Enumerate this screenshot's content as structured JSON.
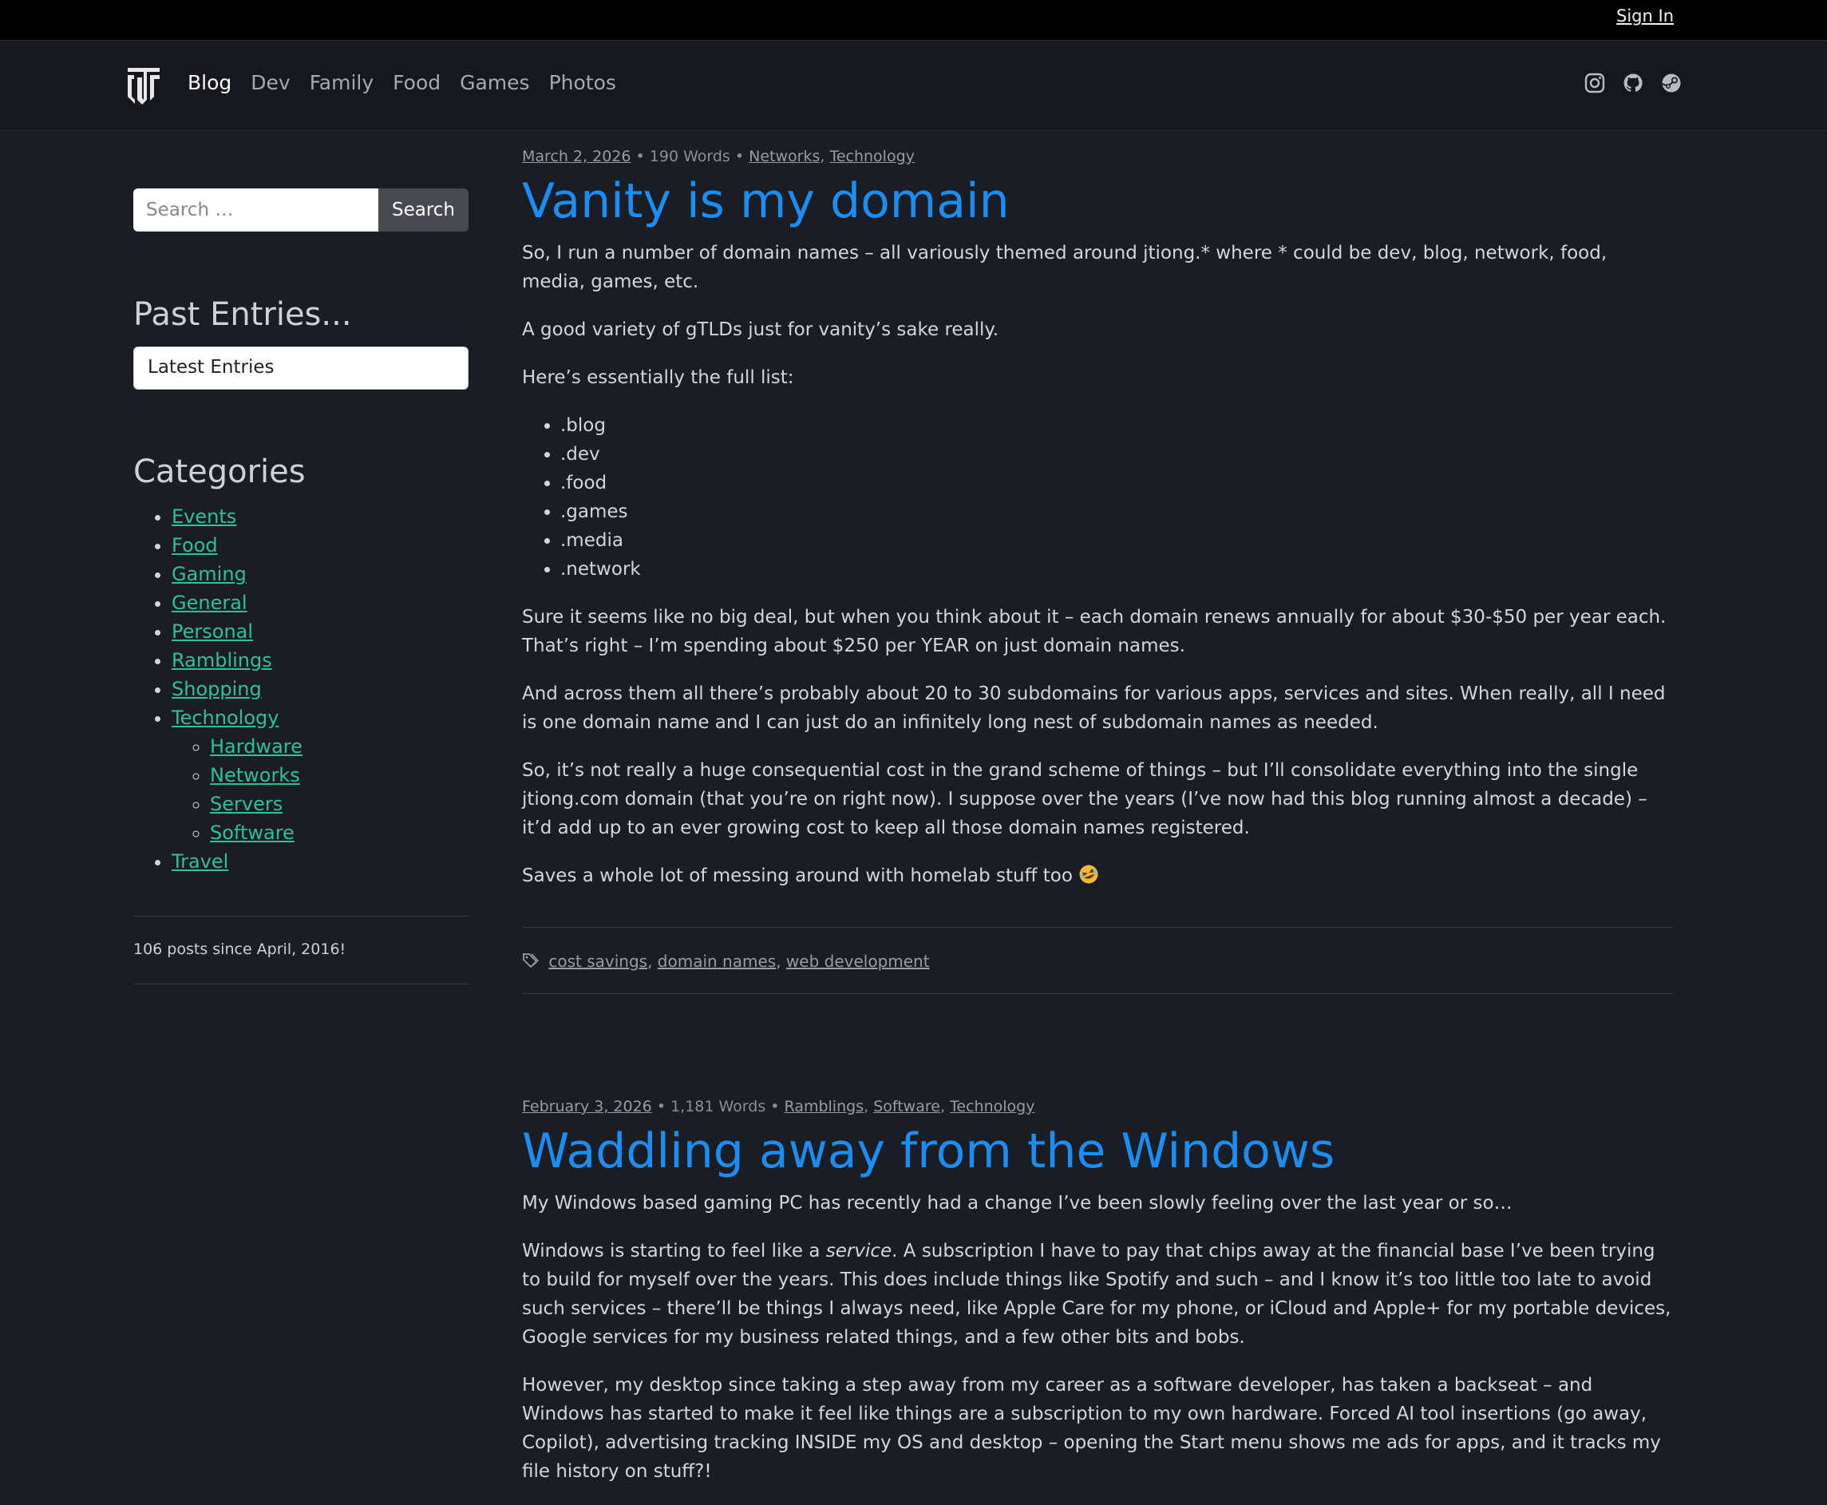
{
  "topbar": {
    "signin_label": "Sign In"
  },
  "nav": {
    "links": [
      "Blog",
      "Dev",
      "Family",
      "Food",
      "Games",
      "Photos"
    ],
    "social_icons": [
      "instagram-icon",
      "github-icon",
      "steam-icon"
    ]
  },
  "sidebar": {
    "search": {
      "placeholder": "Search …",
      "button_label": "Search"
    },
    "past_entries_heading": "Past Entries...",
    "past_entries_selected": "Latest Entries",
    "categories_heading": "Categories",
    "categories": [
      "Events",
      "Food",
      "Gaming",
      "General",
      "Personal",
      "Ramblings",
      "Shopping",
      "Technology"
    ],
    "tech_subcategories": [
      "Hardware",
      "Networks",
      "Servers",
      "Software"
    ],
    "travel": "Travel",
    "posts_count": "106 posts since April, 2016!"
  },
  "posts": [
    {
      "date": "March 2, 2026",
      "words": "190 Words",
      "categories": [
        "Networks",
        "Technology"
      ],
      "title": "Vanity is my domain",
      "p1": "So, I run a number of domain names – all variously themed around jtiong.* where * could be dev, blog, network, food, media, games, etc.",
      "p2": "A good variety of gTLDs just for vanity’s sake really.",
      "p3": "Here’s essentially the full list:",
      "list": [
        ".blog",
        ".dev",
        ".food",
        ".games",
        ".media",
        ".network"
      ],
      "p4": "Sure it seems like no big deal, but when you think about it – each domain renews annually for about $30-$50 per year each. That’s right – I’m spending about $250 per YEAR on just domain names.",
      "p5": "And across them all there’s probably about 20 to 30 subdomains for various apps, services and sites. When really, all I need is one domain name and I can just do an infinitely long nest of subdomain names as needed.",
      "p6": "So, it’s not really a huge consequential cost in the grand scheme of things – but I’ll consolidate everything into the single jtiong.com domain (that you’re on right now). I suppose over the years (I’ve now had this blog running almost a decade) – it’d add up to an ever growing cost to keep all those domain names registered.",
      "p7": "Saves a whole lot of messing around with homelab stuff too",
      "tags": [
        "cost savings",
        "domain names",
        "web development"
      ]
    },
    {
      "date": "February 3, 2026",
      "words": "1,181 Words",
      "categories": [
        "Ramblings",
        "Software",
        "Technology"
      ],
      "title": "Waddling away from the Windows",
      "p1": "My Windows based gaming PC has recently had a change I’ve been slowly feeling over the last year or so…",
      "p2_a": "Windows is starting to feel like a ",
      "p2_em": "service",
      "p2_b": ". A subscription I have to pay that chips away at the financial base I’ve been trying to build for myself over the years. This does include things like Spotify and such – and I know it’s too little too late to avoid such services – there’ll be things I always need, like Apple Care for my phone, or iCloud and Apple+ for my portable devices, Google services for my business related things, and a few other bits and bobs.",
      "p3": "However, my desktop since taking a step away from my career as a software developer, has taken a backseat – and Windows has started to make it feel like things are a subscription to my own hardware. Forced AI tool insertions (go away, Copilot), advertising tracking INSIDE my OS and desktop – opening the Start menu shows me ads for apps, and it tracks my file history on stuff?!"
    }
  ]
}
